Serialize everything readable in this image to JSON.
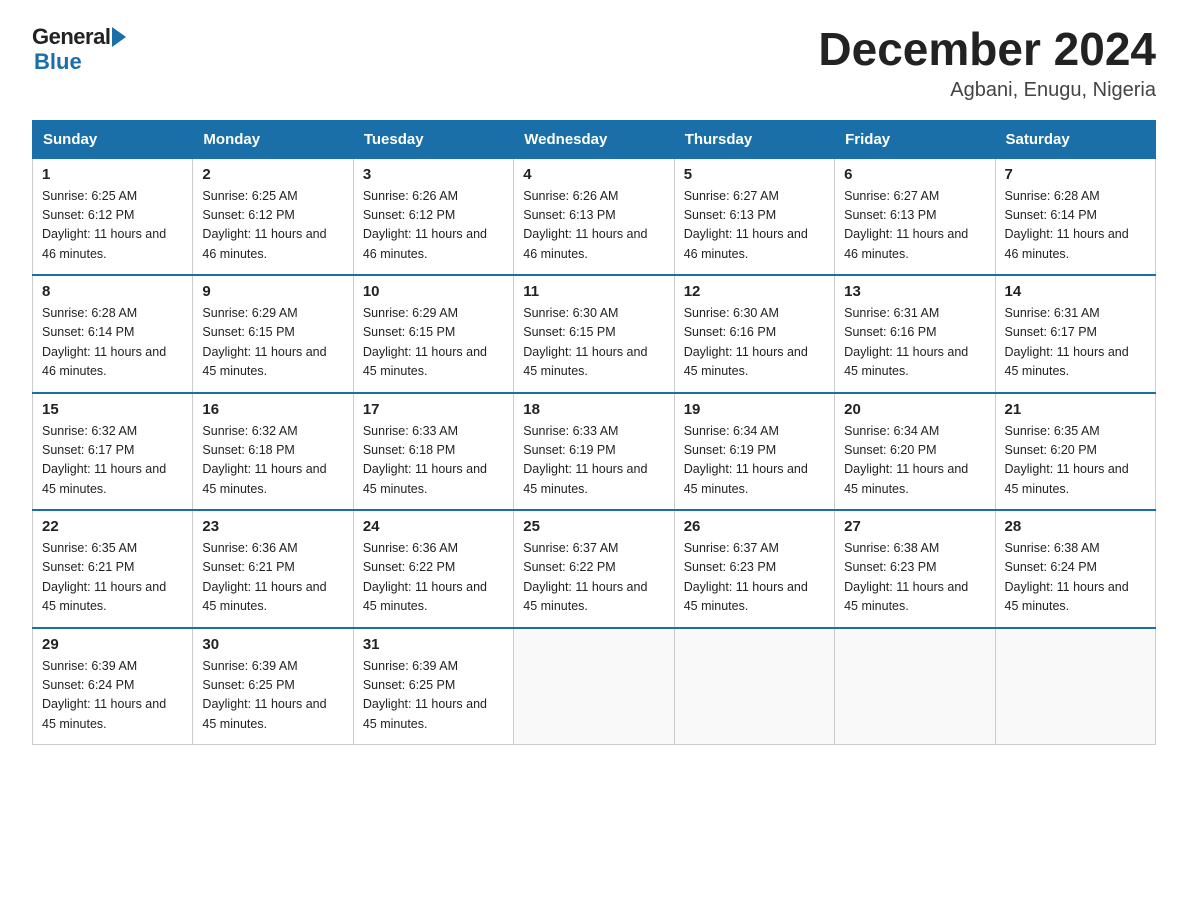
{
  "logo": {
    "general": "General",
    "blue": "Blue"
  },
  "title": "December 2024",
  "location": "Agbani, Enugu, Nigeria",
  "days_header": [
    "Sunday",
    "Monday",
    "Tuesday",
    "Wednesday",
    "Thursday",
    "Friday",
    "Saturday"
  ],
  "weeks": [
    [
      {
        "num": "1",
        "sunrise": "6:25 AM",
        "sunset": "6:12 PM",
        "daylight": "11 hours and 46 minutes."
      },
      {
        "num": "2",
        "sunrise": "6:25 AM",
        "sunset": "6:12 PM",
        "daylight": "11 hours and 46 minutes."
      },
      {
        "num": "3",
        "sunrise": "6:26 AM",
        "sunset": "6:12 PM",
        "daylight": "11 hours and 46 minutes."
      },
      {
        "num": "4",
        "sunrise": "6:26 AM",
        "sunset": "6:13 PM",
        "daylight": "11 hours and 46 minutes."
      },
      {
        "num": "5",
        "sunrise": "6:27 AM",
        "sunset": "6:13 PM",
        "daylight": "11 hours and 46 minutes."
      },
      {
        "num": "6",
        "sunrise": "6:27 AM",
        "sunset": "6:13 PM",
        "daylight": "11 hours and 46 minutes."
      },
      {
        "num": "7",
        "sunrise": "6:28 AM",
        "sunset": "6:14 PM",
        "daylight": "11 hours and 46 minutes."
      }
    ],
    [
      {
        "num": "8",
        "sunrise": "6:28 AM",
        "sunset": "6:14 PM",
        "daylight": "11 hours and 46 minutes."
      },
      {
        "num": "9",
        "sunrise": "6:29 AM",
        "sunset": "6:15 PM",
        "daylight": "11 hours and 45 minutes."
      },
      {
        "num": "10",
        "sunrise": "6:29 AM",
        "sunset": "6:15 PM",
        "daylight": "11 hours and 45 minutes."
      },
      {
        "num": "11",
        "sunrise": "6:30 AM",
        "sunset": "6:15 PM",
        "daylight": "11 hours and 45 minutes."
      },
      {
        "num": "12",
        "sunrise": "6:30 AM",
        "sunset": "6:16 PM",
        "daylight": "11 hours and 45 minutes."
      },
      {
        "num": "13",
        "sunrise": "6:31 AM",
        "sunset": "6:16 PM",
        "daylight": "11 hours and 45 minutes."
      },
      {
        "num": "14",
        "sunrise": "6:31 AM",
        "sunset": "6:17 PM",
        "daylight": "11 hours and 45 minutes."
      }
    ],
    [
      {
        "num": "15",
        "sunrise": "6:32 AM",
        "sunset": "6:17 PM",
        "daylight": "11 hours and 45 minutes."
      },
      {
        "num": "16",
        "sunrise": "6:32 AM",
        "sunset": "6:18 PM",
        "daylight": "11 hours and 45 minutes."
      },
      {
        "num": "17",
        "sunrise": "6:33 AM",
        "sunset": "6:18 PM",
        "daylight": "11 hours and 45 minutes."
      },
      {
        "num": "18",
        "sunrise": "6:33 AM",
        "sunset": "6:19 PM",
        "daylight": "11 hours and 45 minutes."
      },
      {
        "num": "19",
        "sunrise": "6:34 AM",
        "sunset": "6:19 PM",
        "daylight": "11 hours and 45 minutes."
      },
      {
        "num": "20",
        "sunrise": "6:34 AM",
        "sunset": "6:20 PM",
        "daylight": "11 hours and 45 minutes."
      },
      {
        "num": "21",
        "sunrise": "6:35 AM",
        "sunset": "6:20 PM",
        "daylight": "11 hours and 45 minutes."
      }
    ],
    [
      {
        "num": "22",
        "sunrise": "6:35 AM",
        "sunset": "6:21 PM",
        "daylight": "11 hours and 45 minutes."
      },
      {
        "num": "23",
        "sunrise": "6:36 AM",
        "sunset": "6:21 PM",
        "daylight": "11 hours and 45 minutes."
      },
      {
        "num": "24",
        "sunrise": "6:36 AM",
        "sunset": "6:22 PM",
        "daylight": "11 hours and 45 minutes."
      },
      {
        "num": "25",
        "sunrise": "6:37 AM",
        "sunset": "6:22 PM",
        "daylight": "11 hours and 45 minutes."
      },
      {
        "num": "26",
        "sunrise": "6:37 AM",
        "sunset": "6:23 PM",
        "daylight": "11 hours and 45 minutes."
      },
      {
        "num": "27",
        "sunrise": "6:38 AM",
        "sunset": "6:23 PM",
        "daylight": "11 hours and 45 minutes."
      },
      {
        "num": "28",
        "sunrise": "6:38 AM",
        "sunset": "6:24 PM",
        "daylight": "11 hours and 45 minutes."
      }
    ],
    [
      {
        "num": "29",
        "sunrise": "6:39 AM",
        "sunset": "6:24 PM",
        "daylight": "11 hours and 45 minutes."
      },
      {
        "num": "30",
        "sunrise": "6:39 AM",
        "sunset": "6:25 PM",
        "daylight": "11 hours and 45 minutes."
      },
      {
        "num": "31",
        "sunrise": "6:39 AM",
        "sunset": "6:25 PM",
        "daylight": "11 hours and 45 minutes."
      },
      null,
      null,
      null,
      null
    ]
  ]
}
